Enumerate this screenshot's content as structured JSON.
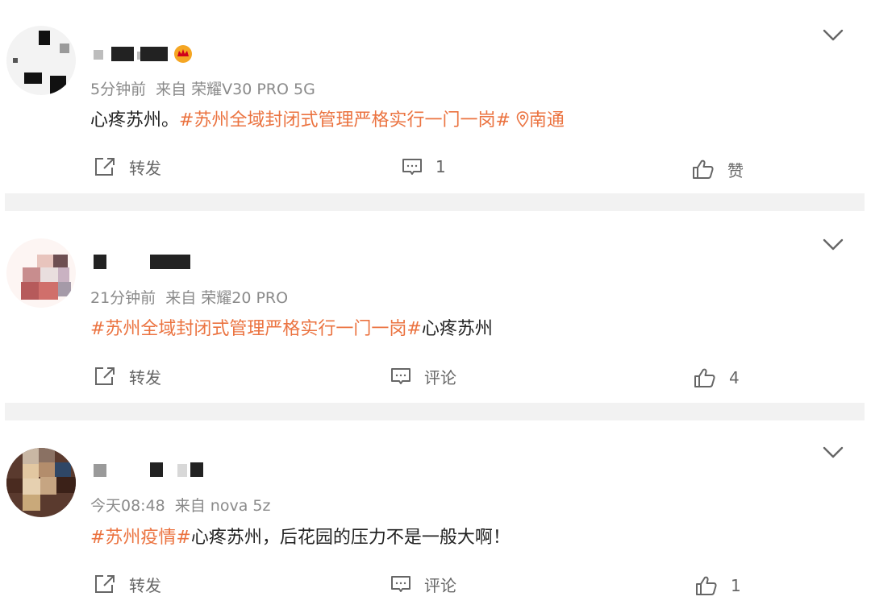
{
  "posts": [
    {
      "meta_time": "5分钟前",
      "meta_source": "来自 荣耀V30 PRO 5G",
      "text_plain": "心疼苏州。",
      "topic": "#苏州全域封闭式管理严格实行一门一岗#",
      "location": "南通",
      "repost_label": "转发",
      "comment_label": "1",
      "like_label": "赞"
    },
    {
      "meta_time": "21分钟前",
      "meta_source": "来自 荣耀20 PRO",
      "topic": "#苏州全域封闭式管理严格实行一门一岗#",
      "text_plain": "心疼苏州",
      "repost_label": "转发",
      "comment_label": "评论",
      "like_label": "4"
    },
    {
      "meta_time": "今天08:48",
      "meta_source": "来自 nova 5z",
      "topic": "#苏州疫情#",
      "text_plain": "心疼苏州，后花园的压力不是一般大啊！",
      "repost_label": "转发",
      "comment_label": "评论",
      "like_label": "1"
    }
  ],
  "icons": {
    "chevron": "chevron-down-icon",
    "repost": "repost-icon",
    "comment": "comment-icon",
    "like": "thumbs-up-icon",
    "location": "location-pin-icon",
    "vip": "crown-icon"
  },
  "colors": {
    "topic": "#eb7340",
    "meta": "#8a8a8a",
    "divider": "#f2f2f2"
  }
}
